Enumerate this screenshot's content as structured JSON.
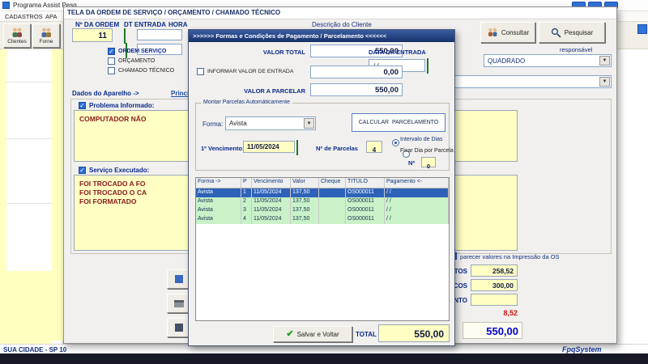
{
  "app": {
    "title": "Programa Assist Pesq",
    "menu_items": [
      "CADASTROS",
      "APA"
    ],
    "toolbar": [
      {
        "label": "Clientes"
      },
      {
        "label": "Forne"
      }
    ],
    "status_left": "SUA CIDADE - SP 10",
    "status_right": "FpqSystem"
  },
  "os": {
    "title": "TELA DA ORDEM DE SERVIÇO / ORÇAMENTO / CHAMADO TÉCNICO",
    "order_label": "Nº DA ORDEM",
    "order_value": "11",
    "dt_label": "DT ENTRADA",
    "hora_label": "HORA",
    "cliente_label": "Descrição do Cliente",
    "types": [
      {
        "label": "ORDEM SERVIÇO",
        "checked": true
      },
      {
        "label": "ORÇAMENTO",
        "checked": false
      },
      {
        "label": "CHAMADO TÉCNICO",
        "checked": false
      }
    ],
    "consultar": "Consultar",
    "pesquisar": "Pesquisar",
    "responsavel_label": "responsável",
    "responsavel_value": "QUADRADO",
    "tab_label": "Dados do Aparelho ->",
    "tab_active": "Principais",
    "problema_label": "Problema Informado:",
    "problema_text": "COMPUTADOR NÃO",
    "servico_label": "Serviço Executado:",
    "servico_lines": [
      "FOI TROCADO A FO",
      "FOI TROCADO O CA",
      "FOI FORMATADO"
    ],
    "impressao_note": "parecer valores na Impressão da OS",
    "totals": [
      {
        "label": "UTOS",
        "value": "258,52"
      },
      {
        "label": "ICOS",
        "value": "300,00"
      },
      {
        "label": "NTO",
        "value": ""
      }
    ],
    "desconto_value": "8,52",
    "total_value": "550,00"
  },
  "dialog": {
    "title": ">>>>>> Formas e Condições de Pagamento / Parcelamento <<<<<<",
    "valor_total_label": "VALOR TOTAL",
    "valor_total": "550,00",
    "data_entrada_label": "DATA DA ENTRADA",
    "data_entrada_value": "/ /",
    "entrada_checkbox_label": "INFORMAR VALOR DE ENTRADA",
    "entrada_value": "0,00",
    "parcelar_label": "VALOR A PARCELAR",
    "parcelar_value": "550,00",
    "group_label": "Montar Parcelas Automáticamente",
    "forma_label": "Forma:",
    "forma_value": "Avista",
    "calcular_button": "CALCULAR  PARCELAMENTO",
    "vencimento_label": "1º Vencimento:",
    "vencimento_value": "11/05/2024",
    "parcelas_label": "Nº de Parcelas",
    "parcelas_value": "4",
    "radio_intervalo": "Intervalo de Dias",
    "radio_fixar": "Fixar Dia por Parcela",
    "n_label": "Nº",
    "n_value": "0",
    "table": {
      "headers": [
        "Forma ->",
        "P",
        "Vencimento",
        "Valor",
        "Cheque",
        "TITULO",
        "Pagamento <-"
      ],
      "rows": [
        [
          "Avista",
          "1",
          "11/05/2024",
          "137,50",
          "",
          "OS000011",
          "/ /"
        ],
        [
          "Avista",
          "2",
          "11/05/2024",
          "137,50",
          "",
          "OS000011",
          "/ /"
        ],
        [
          "Avista",
          "3",
          "11/05/2024",
          "137,50",
          "",
          "OS000011",
          "/ /"
        ],
        [
          "Avista",
          "4",
          "11/05/2024",
          "137,50",
          "",
          "OS000011",
          "/ /"
        ]
      ]
    },
    "salvar_button": "Salvar e Voltar",
    "total_label": "TOTAL",
    "total_value": "550,00"
  }
}
